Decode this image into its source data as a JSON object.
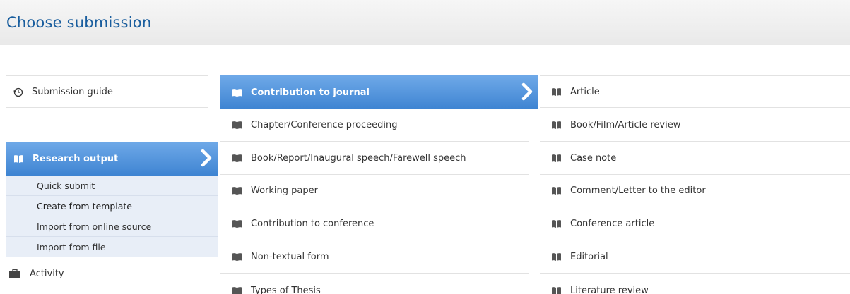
{
  "header": {
    "title": "Choose submission"
  },
  "column1": {
    "guide": "Submission guide",
    "selected": "Research output",
    "submenu": [
      "Quick submit",
      "Create from template",
      "Import from online source",
      "Import from file"
    ],
    "activity": "Activity"
  },
  "column2": {
    "items": [
      "Contribution to journal",
      "Chapter/Conference proceeding",
      "Book/Report/Inaugural speech/Farewell speech",
      "Working paper",
      "Contribution to conference",
      "Non-textual form",
      "Types of Thesis"
    ]
  },
  "column3": {
    "items": [
      "Article",
      "Book/Film/Article review",
      "Case note",
      "Comment/Letter to the editor",
      "Conference article",
      "Editorial",
      "Literature review"
    ]
  },
  "colors": {
    "title": "#1a5e9e",
    "selected_top": "#6fa9e8",
    "selected_bottom": "#3e84d2",
    "submenu_bg": "#e8eef7"
  }
}
